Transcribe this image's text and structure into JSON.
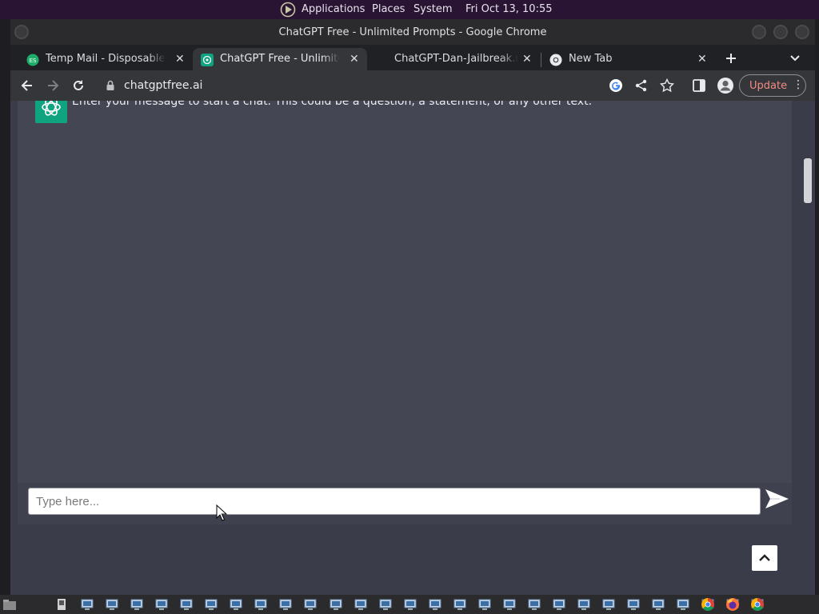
{
  "topbar": {
    "applications": "Applications",
    "places": "Places",
    "system": "System",
    "clock": "Fri Oct 13, 10:55"
  },
  "window": {
    "title": "ChatGPT Free - Unlimited Prompts - Google Chrome"
  },
  "tabs": [
    {
      "label": "Temp Mail - Disposable Temporary Email",
      "icon": "temp-mail-icon",
      "active": false
    },
    {
      "label": "ChatGPT Free - Unlimited Prompts",
      "icon": "chatgpt-icon",
      "active": true
    },
    {
      "label": "ChatGPT-Dan-Jailbreak.md",
      "icon": "none",
      "active": false
    },
    {
      "label": "New Tab",
      "icon": "chrome-icon",
      "active": false
    }
  ],
  "toolbar": {
    "url": "chatgptfree.ai",
    "update_label": "Update"
  },
  "chat": {
    "bot_message": "Enter your message to start a chat. This could be a question, a statement, or any other text.",
    "input_placeholder": "Type here...",
    "input_value": ""
  },
  "colors": {
    "accent_green": "#10a37f",
    "chat_bg": "#444654",
    "page_bg": "#3b3c4a",
    "update_text": "#f28b82"
  },
  "taskbar": {
    "icons": [
      "file-manager-icon",
      "terminal-icon",
      "window-icon",
      "window-icon",
      "window-icon",
      "window-icon",
      "window-icon",
      "window-icon",
      "window-icon",
      "window-icon",
      "window-icon",
      "window-icon",
      "window-icon",
      "window-icon",
      "window-icon",
      "window-icon",
      "window-icon",
      "window-icon",
      "window-icon",
      "window-icon",
      "window-icon",
      "window-icon",
      "window-icon",
      "window-icon",
      "window-icon",
      "window-icon",
      "window-icon",
      "window-icon",
      "window-icon",
      "window-icon",
      "chrome-icon",
      "firefox-icon",
      "chrome-icon"
    ]
  }
}
